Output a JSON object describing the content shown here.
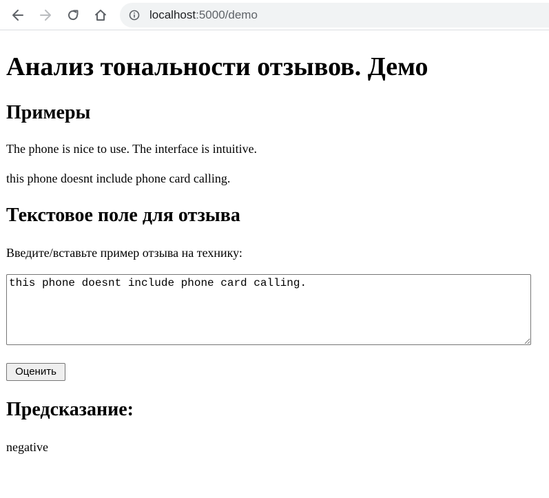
{
  "browser": {
    "url_host": "localhost",
    "url_path": ":5000/demo",
    "icons": [
      "back-arrow-icon",
      "forward-arrow-icon",
      "reload-icon",
      "home-icon",
      "info-icon"
    ]
  },
  "page": {
    "title": "Анализ тональности отзывов. Демо",
    "examples_heading": "Примеры",
    "examples": [
      "The phone is nice to use. The interface is intuitive.",
      "this phone doesnt include phone card calling."
    ],
    "textfield_heading": "Текстовое поле для отзыва",
    "prompt_label": "Введите/вставьте пример отзыва на технику:",
    "textarea_value": "this phone doesnt include phone card calling.",
    "submit_label": "Оценить",
    "prediction_heading": "Предсказание:",
    "prediction_value": "negative"
  }
}
